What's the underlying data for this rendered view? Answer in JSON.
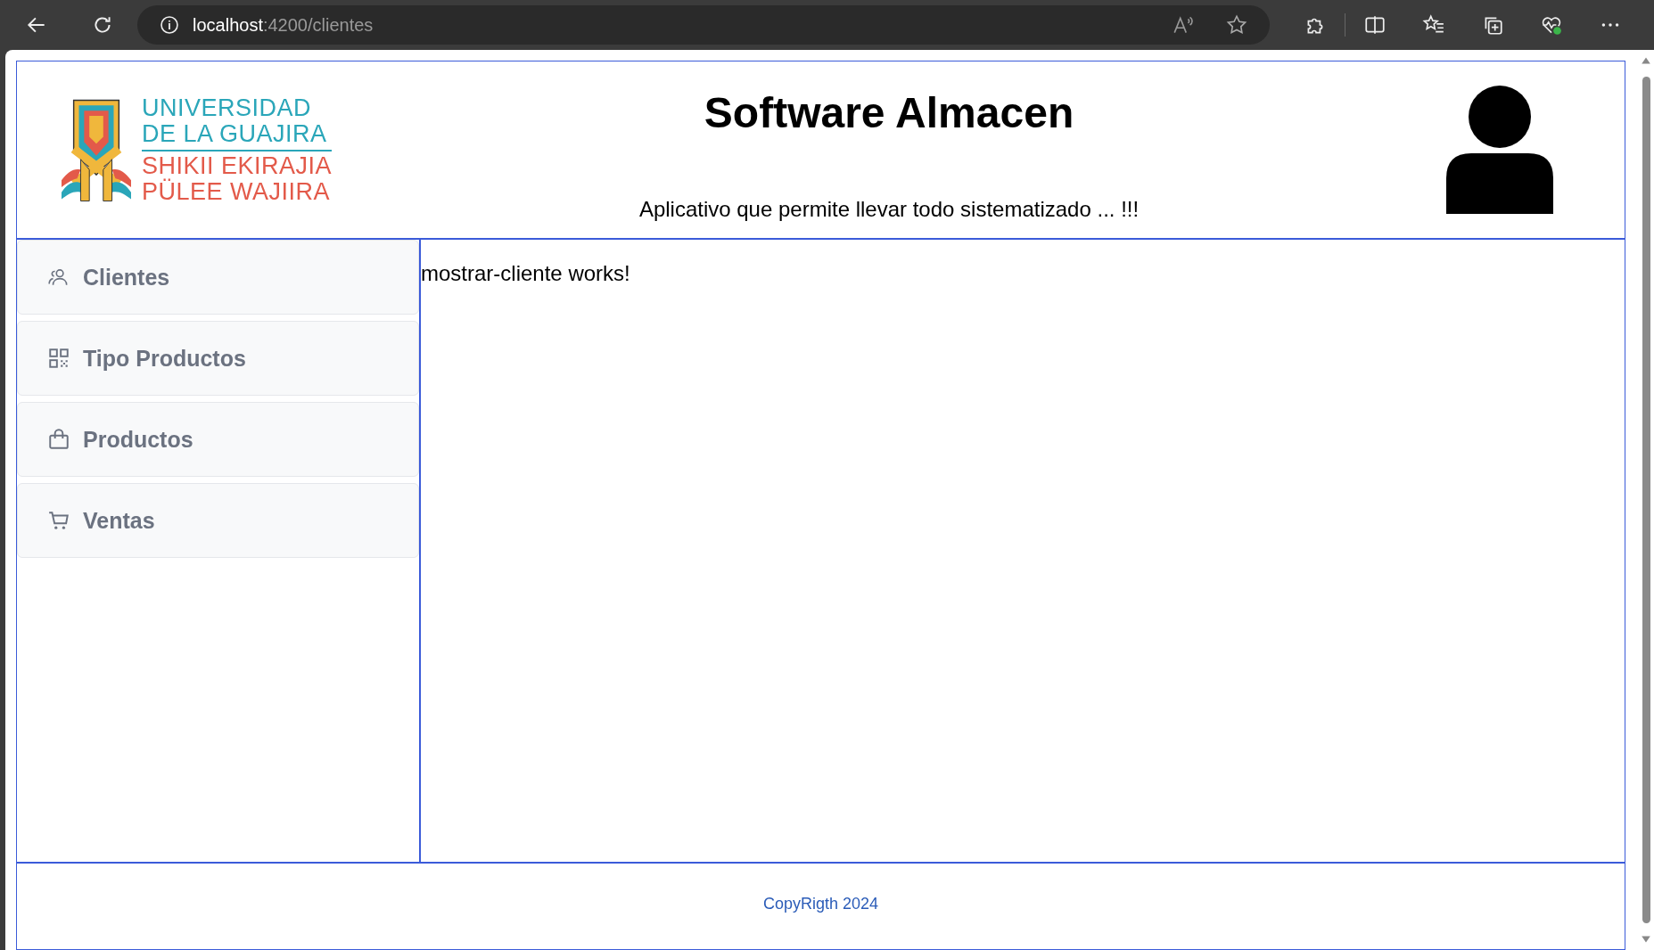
{
  "browser": {
    "address": {
      "host": "localhost",
      "path": ":4200/clientes"
    }
  },
  "header": {
    "logo_lines": [
      {
        "text": "UNIVERSIDAD",
        "kind": "primary"
      },
      {
        "text": "DE LA GUAJIRA",
        "kind": "primary"
      },
      {
        "text": "SHIKII EKIRAJIA",
        "kind": "secondary"
      },
      {
        "text": "PÜLEE WAJIIRA",
        "kind": "secondary"
      }
    ],
    "title": "Software Almacen",
    "subtitle": "Aplicativo que permite llevar todo sistematizado ... !!!"
  },
  "sidebar": {
    "items": [
      {
        "label": "Clientes",
        "kind": "users"
      },
      {
        "label": "Tipo Productos",
        "kind": "grid"
      },
      {
        "label": "Productos",
        "kind": "bag"
      },
      {
        "label": "Ventas",
        "kind": "cart"
      }
    ]
  },
  "content": {
    "text": "mostrar-cliente works!"
  },
  "footer": {
    "text": "CopyRigth 2024"
  }
}
